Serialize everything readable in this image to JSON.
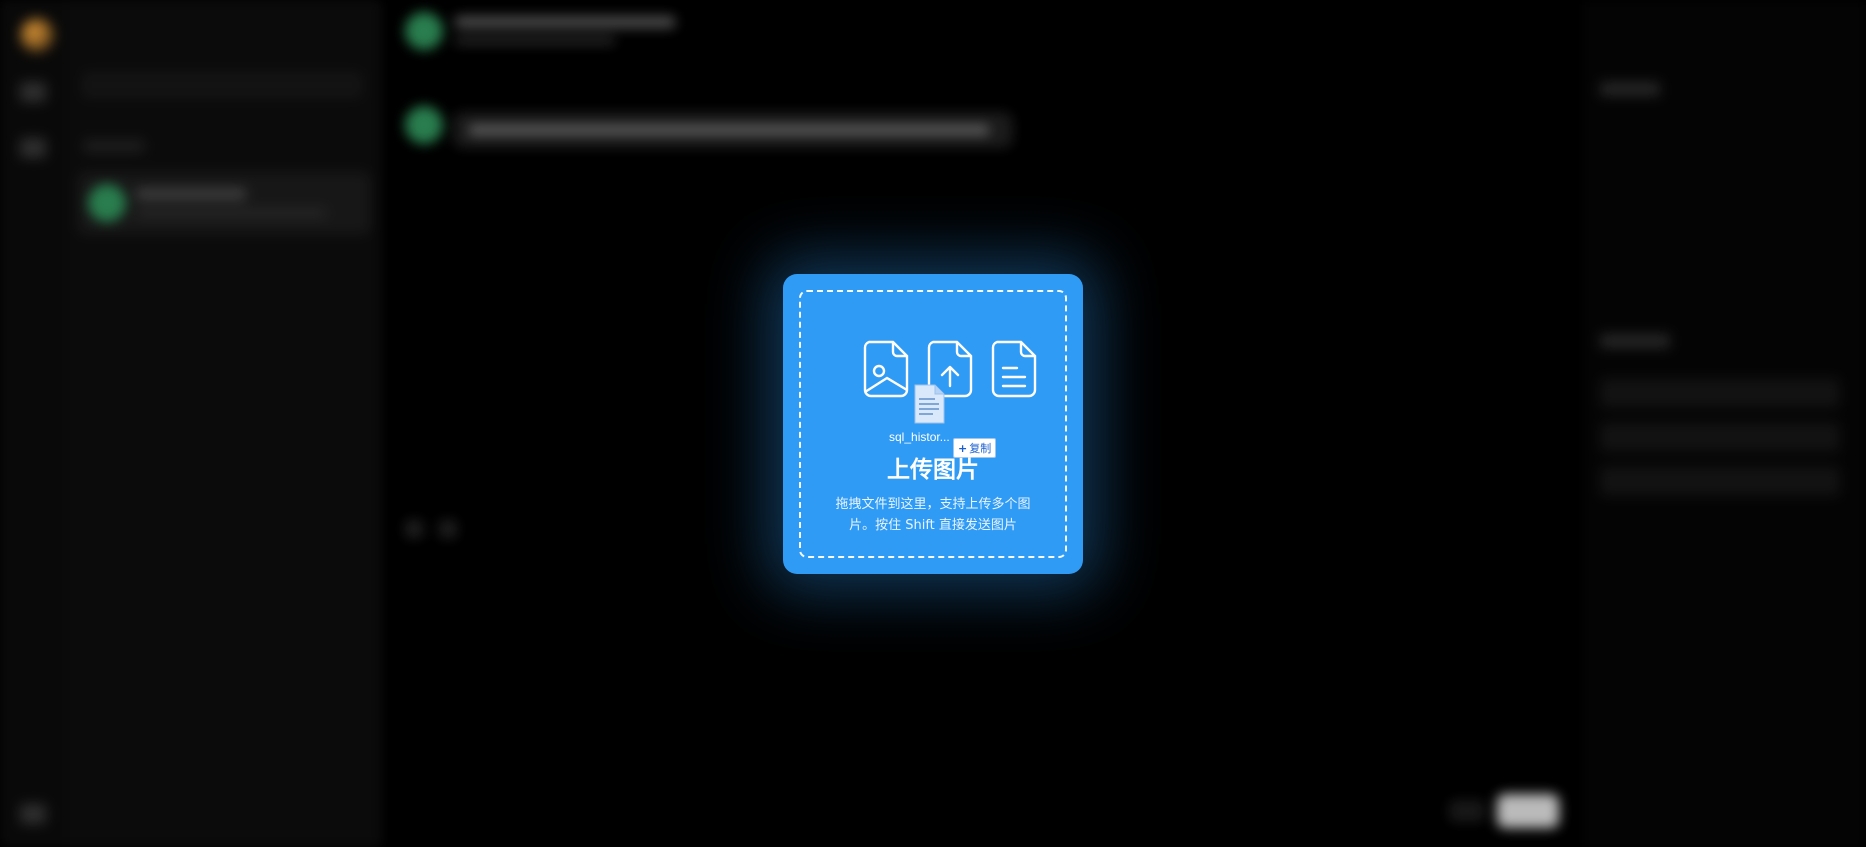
{
  "dropzone": {
    "title": "上传图片",
    "description": "拖拽文件到这里，支持上传多个图片。按住 Shift 直接发送图片",
    "dragged_file_name": "sql_histor...",
    "copy_badge": "复制",
    "accent_color": "#2f9bf5",
    "icons": [
      "image-file-icon",
      "upload-file-icon",
      "text-file-icon"
    ]
  }
}
